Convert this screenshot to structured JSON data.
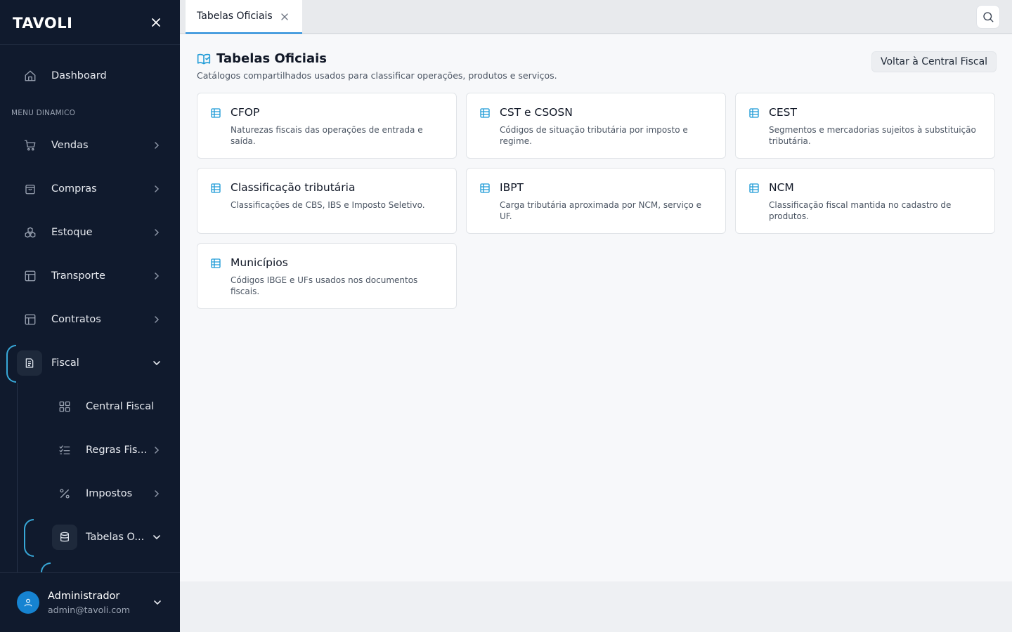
{
  "brand": {
    "name": "TAVOLI"
  },
  "sidebar": {
    "dashboard_label": "Dashboard",
    "section_label": "MENU DINAMICO",
    "items": [
      {
        "label": "Vendas",
        "icon": "cart-icon"
      },
      {
        "label": "Compras",
        "icon": "bag-icon"
      },
      {
        "label": "Estoque",
        "icon": "boxes-icon"
      },
      {
        "label": "Transporte",
        "icon": "layout-icon"
      },
      {
        "label": "Contratos",
        "icon": "layout-icon"
      },
      {
        "label": "Fiscal",
        "icon": "document-icon",
        "expanded": true
      }
    ],
    "fiscal_children": [
      {
        "label": "Central Fiscal",
        "icon": "grid-icon"
      },
      {
        "label": "Regras Fis...",
        "icon": "checklist-icon"
      },
      {
        "label": "Impostos",
        "icon": "percent-icon"
      },
      {
        "label": "Tabelas O...",
        "icon": "database-icon",
        "expanded": true
      }
    ]
  },
  "user": {
    "name": "Administrador",
    "email": "admin@tavoli.com"
  },
  "tabs": [
    {
      "label": "Tabelas Oficiais",
      "active": true
    }
  ],
  "page": {
    "title": "Tabelas Oficiais",
    "subtitle": "Catálogos compartilhados usados para classificar operações, produtos e serviços.",
    "back_button": "Voltar à Central Fiscal"
  },
  "cards": [
    {
      "title": "CFOP",
      "description": "Naturezas fiscais das operações de entrada e saída."
    },
    {
      "title": "CST e CSOSN",
      "description": "Códigos de situação tributária por imposto e regime."
    },
    {
      "title": "CEST",
      "description": "Segmentos e mercadorias sujeitos à substituição tributária."
    },
    {
      "title": "Classificação tributária",
      "description": "Classificações de CBS, IBS e Imposto Seletivo."
    },
    {
      "title": "IBPT",
      "description": "Carga tributária aproximada por NCM, serviço e UF."
    },
    {
      "title": "NCM",
      "description": "Classificação fiscal mantida no cadastro de produtos."
    },
    {
      "title": "Municípios",
      "description": "Códigos IBGE e UFs usados nos documentos fiscais."
    }
  ],
  "colors": {
    "sidebar_bg": "#101a2d",
    "accent": "#1e88d8",
    "active_arc": "#38a8d8",
    "card_icon": "#1e9bd7"
  }
}
